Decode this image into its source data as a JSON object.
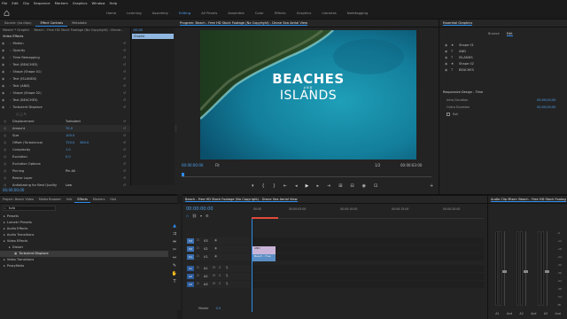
{
  "menu": [
    "File",
    "Edit",
    "Clip",
    "Sequence",
    "Markers",
    "Graphics",
    "Window",
    "Help"
  ],
  "workspaces": [
    {
      "label": "Home"
    },
    {
      "label": "Learning"
    },
    {
      "label": "Assembly"
    },
    {
      "label": "Editing",
      "active": true
    },
    {
      "label": "All Panels"
    },
    {
      "label": "Assemble"
    },
    {
      "label": "Color"
    },
    {
      "label": "Effects"
    },
    {
      "label": "Graphics"
    },
    {
      "label": "Libraries"
    },
    {
      "label": "Notetagging"
    }
  ],
  "source_panel": {
    "tabs": [
      "Source: (no clips)",
      "Effect Controls",
      "Metadata"
    ],
    "master_label": "Master * Graphic",
    "clip_label": "Beach - Free HD Stock Footage (No Copyright) - Drone...",
    "section": "Video Effects",
    "timecode_right": ";00;00",
    "graphic_clip": "Graphic",
    "rows": [
      {
        "label": "Motion",
        "indent": 1
      },
      {
        "label": "Opacity",
        "indent": 1
      },
      {
        "label": "Time Remapping",
        "indent": 1
      },
      {
        "label": "Text (BEACHES)",
        "indent": 1
      },
      {
        "label": "Shape (Shape 01)",
        "indent": 1
      },
      {
        "label": "Text (ISLANDS)",
        "indent": 1
      },
      {
        "label": "Text (AND)",
        "indent": 1
      },
      {
        "label": "Shape (Shape 02)",
        "indent": 1
      },
      {
        "label": "Text (BEACHES)",
        "indent": 1
      },
      {
        "label": "Turbulent Displace",
        "indent": 1
      }
    ],
    "params": [
      {
        "label": "Displacement",
        "value": "Turbulent"
      },
      {
        "label": "Amount",
        "value": "70.0"
      },
      {
        "label": "Size",
        "value": "100.0"
      },
      {
        "label": "Offset (Turbulence)",
        "value": "720.0",
        "value2": "360.0"
      },
      {
        "label": "Complexity",
        "value": "1.0"
      },
      {
        "label": "Evolution",
        "value": "0.0"
      },
      {
        "label": "Evolution Options",
        "value": ""
      },
      {
        "label": "Pinning",
        "value": "Pin All"
      },
      {
        "label": "Resize Layer",
        "value": ""
      },
      {
        "label": "Antialiasing for Best Quality",
        "value": "Low"
      }
    ],
    "footer_time": "00;00;00;00"
  },
  "program": {
    "title": "Program: Beach - Free HD Stock Footage (No Copyright) - Drone Sea Aerial View",
    "overlay_line1": "BEACHES",
    "overlay_and": "AND",
    "overlay_line2": "ISLANDS",
    "timecode": "00:00:00:00",
    "fit": "Fit",
    "quality": "1/2",
    "duration": "00:00:03:00"
  },
  "essential": {
    "title": "Essential Graphics",
    "tabs": [
      "Browse",
      "Edit"
    ],
    "layers": [
      "Shape 01",
      "AND",
      "ISLANDS",
      "Shape 02",
      "BEACHES"
    ],
    "section": "Responsive Design - Time",
    "intro_label": "Intro Duration",
    "intro_value": "00;00;00;00",
    "outro_label": "Outro Duration",
    "outro_value": "00;00;00;00",
    "roll_label": "Roll"
  },
  "project": {
    "tabs": [
      "Project: Beach Video",
      "Media Browser",
      "Info",
      "Effects",
      "Markers",
      "Hist"
    ],
    "search_placeholder": "turb",
    "tree": [
      {
        "label": "Presets",
        "depth": 0
      },
      {
        "label": "Lumetri Presets",
        "depth": 0
      },
      {
        "label": "Audio Effects",
        "depth": 0
      },
      {
        "label": "Audio Transitions",
        "depth": 0
      },
      {
        "label": "Video Effects",
        "depth": 0
      },
      {
        "label": "Distort",
        "depth": 1
      },
      {
        "label": "Turbulent Displace",
        "depth": 2,
        "selected": true
      },
      {
        "label": "Video Transitions",
        "depth": 0
      },
      {
        "label": "Proxyfields",
        "depth": 0
      }
    ]
  },
  "timeline": {
    "title": "Beach - Free HD Stock Footage (No Copyright) - Drone Sea Aerial View",
    "timecode": "00:00:00:00",
    "ruler": [
      "00:00",
      "00:00:05:00",
      "00:00:10:00",
      "00:00:15:00",
      "00:00:20:00"
    ],
    "video_tracks": [
      "V3",
      "V2",
      "V1"
    ],
    "audio_tracks": [
      "A1",
      "A2",
      "A3"
    ],
    "master": "Master",
    "master_val": "0.0",
    "clip_graphic": "AND",
    "clip_video": "Beach - Free"
  },
  "audio_mixer": {
    "title": "Audio Clip Mixer: Beach - Free HD Stock Footag",
    "channels": [
      "A1",
      "Aud",
      "A2",
      "Aud",
      "A3",
      "Aud"
    ],
    "scale": [
      "-6",
      "-12",
      "-18",
      "-24",
      "-30",
      "-36",
      "-42",
      "-48",
      "-54",
      "dB"
    ]
  },
  "colors": {
    "accent": "#2d8ceb",
    "video_clip": "#5a8ec4",
    "graphic_clip": "#c9b4d7",
    "playhead": "#e04b3a"
  }
}
